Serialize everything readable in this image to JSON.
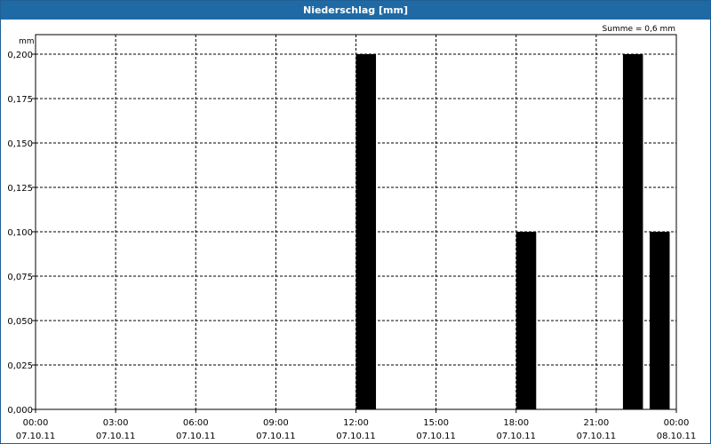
{
  "window": {
    "title": "Niederschlag [mm]"
  },
  "chart_data": {
    "type": "bar",
    "title": "Niederschlag [mm]",
    "ylabel": "mm",
    "summary": "Summe = 0,6 mm",
    "ylim": [
      0,
      0.2
    ],
    "yticks": [
      "0,000",
      "0,025",
      "0,050",
      "0,075",
      "0,100",
      "0,125",
      "0,150",
      "0,175",
      "0,200"
    ],
    "xlim_hours": [
      0,
      24
    ],
    "xticks": [
      {
        "time": "00:00",
        "date": "07.10.11"
      },
      {
        "time": "03:00",
        "date": "07.10.11"
      },
      {
        "time": "06:00",
        "date": "07.10.11"
      },
      {
        "time": "09:00",
        "date": "07.10.11"
      },
      {
        "time": "12:00",
        "date": "07.10.11"
      },
      {
        "time": "15:00",
        "date": "07.10.11"
      },
      {
        "time": "18:00",
        "date": "07.10.11"
      },
      {
        "time": "21:00",
        "date": "07.10.11"
      },
      {
        "time": "00:00",
        "date": "08.10.11"
      }
    ],
    "grid": true,
    "bars": [
      {
        "start": "12:00",
        "end": "12:45",
        "value": 0.2
      },
      {
        "start": "18:00",
        "end": "18:45",
        "value": 0.1
      },
      {
        "start": "22:00",
        "end": "22:45",
        "value": 0.2
      },
      {
        "start": "23:00",
        "end": "23:45",
        "value": 0.1
      }
    ],
    "bar_color": "#000000"
  }
}
